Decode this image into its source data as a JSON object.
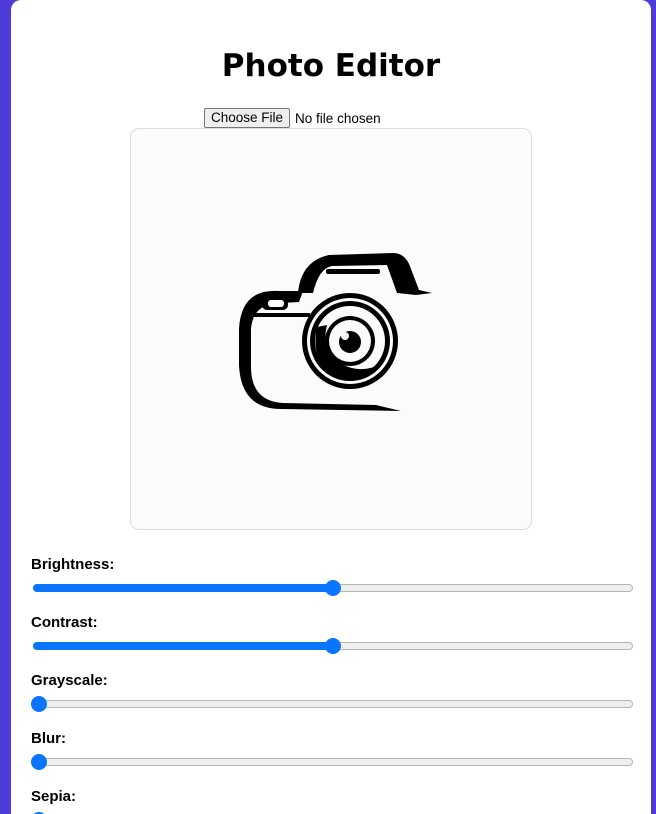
{
  "app": {
    "title": "Photo Editor"
  },
  "file_input": {
    "button_label": "Choose File",
    "status": "No file chosen"
  },
  "preview": {
    "icon": "camera-icon"
  },
  "controls": [
    {
      "id": "brightness",
      "label": "Brightness:",
      "value": 0.5
    },
    {
      "id": "contrast",
      "label": "Contrast:",
      "value": 0.5
    },
    {
      "id": "grayscale",
      "label": "Grayscale:",
      "value": 0.0
    },
    {
      "id": "blur",
      "label": "Blur:",
      "value": 0.0
    },
    {
      "id": "sepia",
      "label": "Sepia:",
      "value": 0.0
    }
  ],
  "colors": {
    "background": "#4f3bd9",
    "accent": "#0a75ff",
    "card": "#ffffff"
  }
}
